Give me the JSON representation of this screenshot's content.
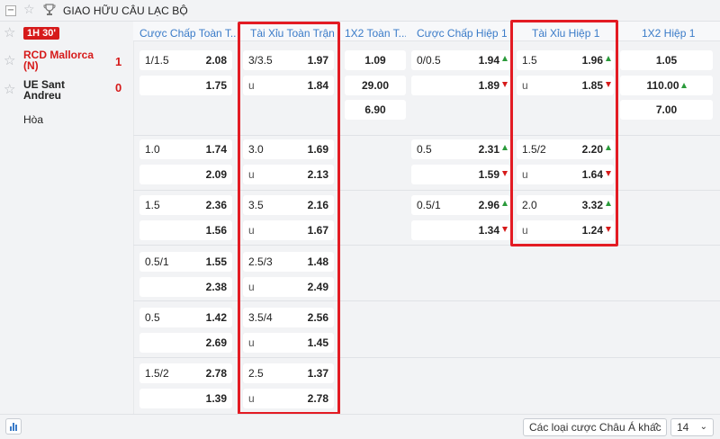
{
  "league": {
    "name": "GIAO HỮU CÂU LẠC BỘ",
    "collapse_icon": "−"
  },
  "match": {
    "period": "1H",
    "minute": "30'",
    "home": {
      "name": "RCD Mallorca (N)",
      "score": "1"
    },
    "away": {
      "name": "UE Sant Andreu",
      "score": "0"
    },
    "draw_label": "Hòa"
  },
  "columns": {
    "ah_full": "Cược Chấp Toàn T...",
    "ou_full": "Tài Xỉu Toàn Trận",
    "x12_full": "1X2 Toàn T...",
    "ah_h1": "Cược Chấp Hiệp 1",
    "ou_h1": "Tài Xỉu Hiệp 1",
    "x12_h1": "1X2 Hiệp 1"
  },
  "odds": {
    "ah_full": [
      {
        "line": "1/1.5",
        "home": "2.08",
        "away": "1.75"
      },
      {
        "line": "1.0",
        "home": "1.74",
        "away": "2.09"
      },
      {
        "line": "1.5",
        "home": "2.36",
        "away": "1.56"
      },
      {
        "line": "0.5/1",
        "home": "1.55",
        "away": "2.38"
      },
      {
        "line": "0.5",
        "home": "1.42",
        "away": "2.69"
      },
      {
        "line": "1.5/2",
        "home": "2.78",
        "away": "1.39"
      }
    ],
    "ou_full": [
      {
        "line": "3/3.5",
        "over": "1.97",
        "under_label": "u",
        "under": "1.84"
      },
      {
        "line": "3.0",
        "over": "1.69",
        "under_label": "u",
        "under": "2.13"
      },
      {
        "line": "3.5",
        "over": "2.16",
        "under_label": "u",
        "under": "1.67"
      },
      {
        "line": "2.5/3",
        "over": "1.48",
        "under_label": "u",
        "under": "2.49"
      },
      {
        "line": "3.5/4",
        "over": "2.56",
        "under_label": "u",
        "under": "1.45"
      },
      {
        "line": "2.5",
        "over": "1.37",
        "under_label": "u",
        "under": "2.78"
      }
    ],
    "x12_full": {
      "home": "1.09",
      "away": "29.00",
      "draw": "6.90"
    },
    "ah_h1": [
      {
        "line": "0/0.5",
        "home": "1.94",
        "away": "1.89"
      },
      {
        "line": "0.5",
        "home": "2.31",
        "away": "1.59"
      },
      {
        "line": "0.5/1",
        "home": "2.96",
        "away": "1.34"
      }
    ],
    "ou_h1": [
      {
        "line": "1.5",
        "over": "1.96",
        "under_label": "u",
        "under": "1.85"
      },
      {
        "line": "1.5/2",
        "over": "2.20",
        "under_label": "u",
        "under": "1.64"
      },
      {
        "line": "2.0",
        "over": "3.32",
        "under_label": "u",
        "under": "1.24"
      }
    ],
    "x12_h1": {
      "home": "1.05",
      "away": "110.00",
      "draw": "7.00"
    }
  },
  "footer": {
    "other_bets": "Các loại cược Châu Á khác",
    "page_size": "14"
  },
  "colors": {
    "accent_red": "#e31b23",
    "link_blue": "#3a7bc8",
    "up_green": "#2a9a3a",
    "down_red": "#d61a1a"
  }
}
